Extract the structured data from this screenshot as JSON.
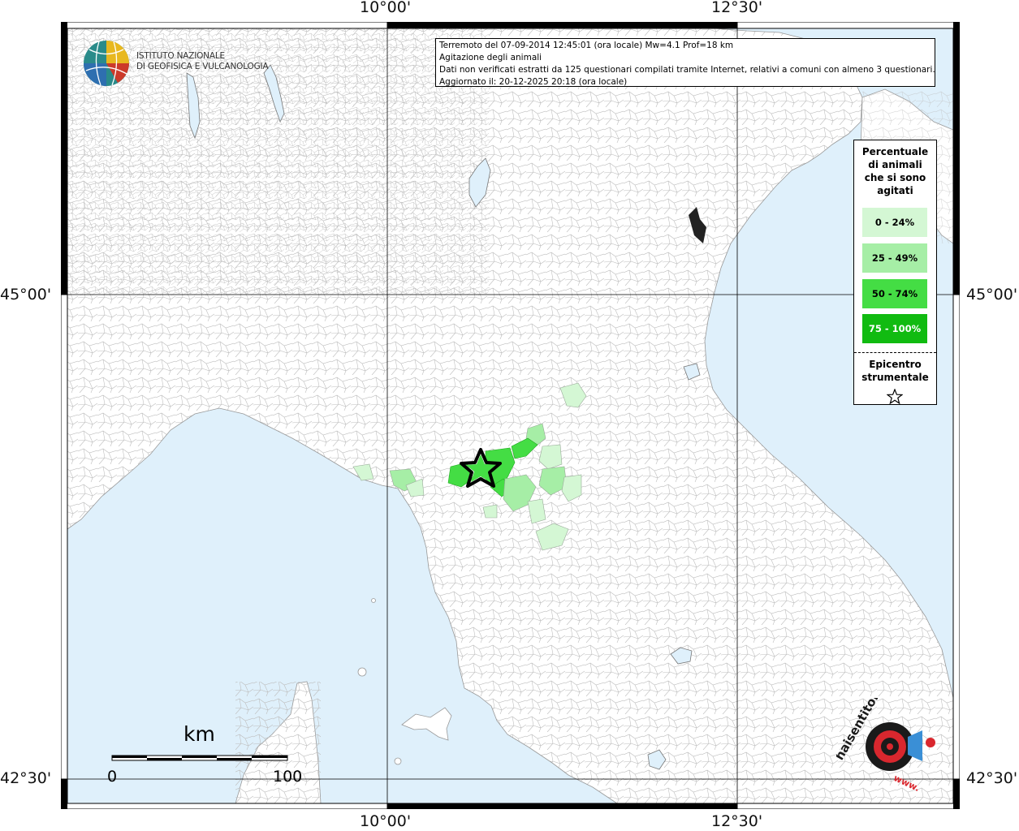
{
  "coordinates": {
    "top_left_lon": "10°00'",
    "top_right_lon": "12°30'",
    "bottom_left_lon": "10°00'",
    "bottom_right_lon": "12°30'",
    "left_upper_lat": "45°00'",
    "left_lower_lat": "42°30'",
    "right_upper_lat": "45°00'",
    "right_lower_lat": "42°30'"
  },
  "info": {
    "line1": "Terremoto del 07-09-2014 12:45:01 (ora locale) Mw=4.1 Prof=18 km",
    "line2": "Agitazione degli animali",
    "line3": "Dati non verificati estratti da 125 questionari compilati tramite Internet, relativi a comuni con almeno 3 questionari.",
    "line4": "Aggiornato il: 20-12-2025 20:18 (ora locale)"
  },
  "institute": {
    "line1": "ISTITUTO NAZIONALE",
    "line2": "DI GEOFISICA E VULCANOLOGIA"
  },
  "legend": {
    "title_line1": "Percentuale",
    "title_line2": "di animali",
    "title_line3": "che si sono",
    "title_line4": "agitati",
    "items": [
      {
        "label": "0 - 24%",
        "color": "#d4f7d4"
      },
      {
        "label": "25 - 49%",
        "color": "#a6eea6"
      },
      {
        "label": "50 - 74%",
        "color": "#44dd44"
      },
      {
        "label": "75 - 100%",
        "color": "#11bb11"
      }
    ],
    "epicenter_line1": "Epicentro",
    "epicenter_line2": "strumentale"
  },
  "scale": {
    "unit": "km",
    "start": "0",
    "end": "100"
  },
  "colors": {
    "sea": "#dff0fb",
    "land": "#ffffff",
    "border": "#b8b8b8"
  },
  "watermark": {
    "brand": "haisentitoilterremoto.it",
    "prefix": "www."
  }
}
